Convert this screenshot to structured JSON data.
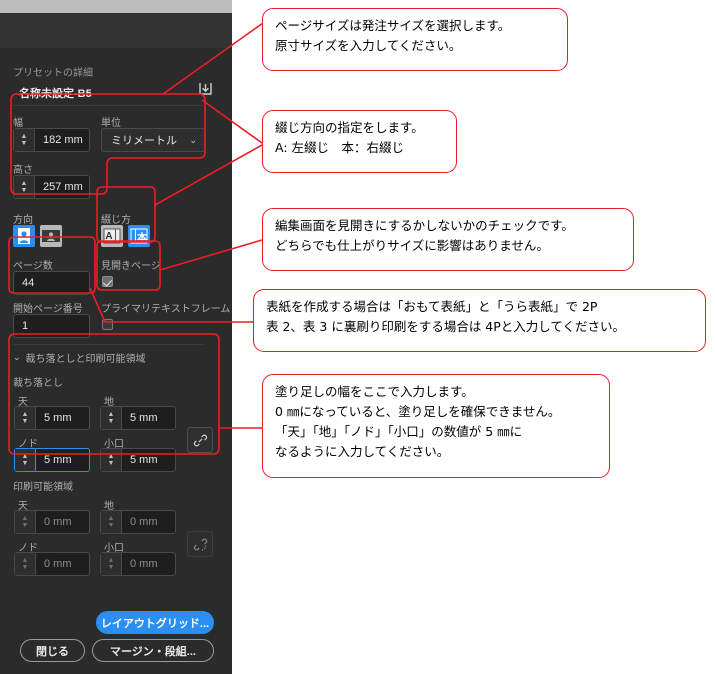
{
  "dialog": {
    "preset_section_label": "プリセットの詳細",
    "preset_name": "名称未設定-B5",
    "save_preset_icon": "save-preset-icon",
    "width": {
      "label": "幅",
      "value": "182 mm"
    },
    "unit": {
      "label": "単位",
      "value": "ミリメートル",
      "chevron": "⌄"
    },
    "height": {
      "label": "高さ",
      "value": "257 mm"
    },
    "orientation": {
      "label": "方向",
      "portrait_icon": "portrait-orientation-icon",
      "landscape_icon": "landscape-orientation-icon",
      "selected": "portrait"
    },
    "binding": {
      "label": "綴じ方",
      "left_icon_text": "A",
      "right_icon_text": "本",
      "selected": "right"
    },
    "page_count": {
      "label": "ページ数",
      "value": "44"
    },
    "facing_pages": {
      "label": "見開きページ",
      "checked": true
    },
    "start_page": {
      "label": "開始ページ番号",
      "value": "1"
    },
    "primary_text_frame": {
      "label": "プライマリテキストフレーム",
      "checked": false
    },
    "bleed_section_header": {
      "label": "裁ち落としと印刷可能領域",
      "chevron": "⌄"
    },
    "bleed": {
      "label": "裁ち落とし",
      "top": {
        "label": "天",
        "value": "5 mm"
      },
      "bottom": {
        "label": "地",
        "value": "5 mm"
      },
      "inside": {
        "label": "ノド",
        "value": "5 mm",
        "focused": true
      },
      "outside": {
        "label": "小口",
        "value": "5 mm"
      },
      "link_icon": "chain-link-icon",
      "linked": true
    },
    "slug": {
      "label": "印刷可能領域",
      "top": {
        "label": "天",
        "value": "0 mm"
      },
      "bottom": {
        "label": "地",
        "value": "0 mm"
      },
      "inside": {
        "label": "ノド",
        "value": "0 mm"
      },
      "outside": {
        "label": "小口",
        "value": "0 mm"
      },
      "link_icon": "chain-link-broken-icon",
      "linked": false
    },
    "buttons": {
      "layout_grid": "レイアウトグリッド...",
      "close": "閉じる",
      "margins_columns": "マージン・段組..."
    }
  },
  "annotations": [
    {
      "id": "page-size",
      "text": "ページサイズは発注サイズを選択します。\n原寸サイズを入力してください。"
    },
    {
      "id": "binding-direction",
      "text": "綴じ方向の指定をします。\nA: 左綴じ　本：右綴じ"
    },
    {
      "id": "facing-pages",
      "text": "編集画面を見開きにするかしないかのチェックです。\nどちらでも仕上がりサイズに影響はありません。"
    },
    {
      "id": "page-count",
      "text": "表紙を作成する場合は「おもて表紙」と「うら表紙」で 2P\n表 2、表 3 に裏刷り印刷をする場合は 4Pと入力してください。"
    },
    {
      "id": "bleed",
      "text": "塗り足しの幅をここで入力します。\n0 ㎜になっていると、塗り足しを確保できません。\n「天」「地」「ノド」「小口」の数値が 5 ㎜に\nなるように入力してください。"
    }
  ],
  "colors": {
    "annotation_red": "#ee1c25",
    "accent_blue": "#2a8ff0",
    "panel_bg": "#2b2b2b"
  }
}
